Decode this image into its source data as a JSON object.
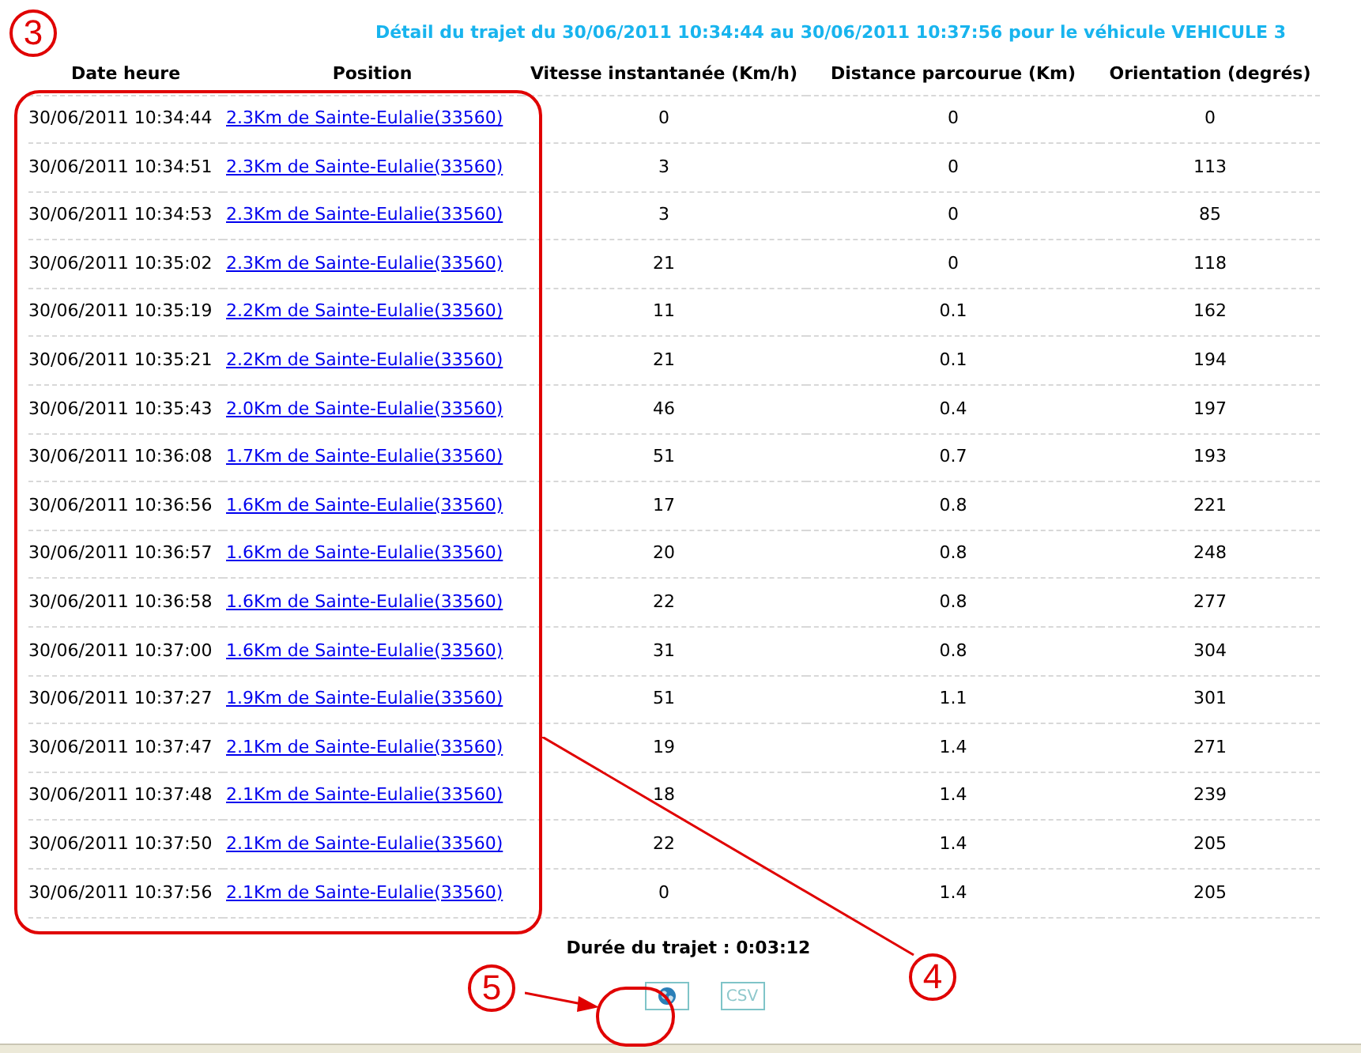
{
  "title": "Détail du trajet du 30/06/2011 10:34:44 au 30/06/2011 10:37:56 pour le véhicule VEHICULE 3",
  "columns": [
    "Date heure",
    "Position",
    "Vitesse instantanée (Km/h)",
    "Distance parcourue (Km)",
    "Orientation (degrés)"
  ],
  "rows": [
    {
      "date": "30/06/2011 10:34:44",
      "position": "2.3Km de Sainte-Eulalie(33560)",
      "speed": "0",
      "distance": "0",
      "orientation": "0"
    },
    {
      "date": "30/06/2011 10:34:51",
      "position": "2.3Km de Sainte-Eulalie(33560)",
      "speed": "3",
      "distance": "0",
      "orientation": "113"
    },
    {
      "date": "30/06/2011 10:34:53",
      "position": "2.3Km de Sainte-Eulalie(33560)",
      "speed": "3",
      "distance": "0",
      "orientation": "85"
    },
    {
      "date": "30/06/2011 10:35:02",
      "position": "2.3Km de Sainte-Eulalie(33560)",
      "speed": "21",
      "distance": "0",
      "orientation": "118"
    },
    {
      "date": "30/06/2011 10:35:19",
      "position": "2.2Km de Sainte-Eulalie(33560)",
      "speed": "11",
      "distance": "0.1",
      "orientation": "162"
    },
    {
      "date": "30/06/2011 10:35:21",
      "position": "2.2Km de Sainte-Eulalie(33560)",
      "speed": "21",
      "distance": "0.1",
      "orientation": "194"
    },
    {
      "date": "30/06/2011 10:35:43",
      "position": "2.0Km de Sainte-Eulalie(33560)",
      "speed": "46",
      "distance": "0.4",
      "orientation": "197"
    },
    {
      "date": "30/06/2011 10:36:08",
      "position": "1.7Km de Sainte-Eulalie(33560)",
      "speed": "51",
      "distance": "0.7",
      "orientation": "193"
    },
    {
      "date": "30/06/2011 10:36:56",
      "position": "1.6Km de Sainte-Eulalie(33560)",
      "speed": "17",
      "distance": "0.8",
      "orientation": "221"
    },
    {
      "date": "30/06/2011 10:36:57",
      "position": "1.6Km de Sainte-Eulalie(33560)",
      "speed": "20",
      "distance": "0.8",
      "orientation": "248"
    },
    {
      "date": "30/06/2011 10:36:58",
      "position": "1.6Km de Sainte-Eulalie(33560)",
      "speed": "22",
      "distance": "0.8",
      "orientation": "277"
    },
    {
      "date": "30/06/2011 10:37:00",
      "position": "1.6Km de Sainte-Eulalie(33560)",
      "speed": "31",
      "distance": "0.8",
      "orientation": "304"
    },
    {
      "date": "30/06/2011 10:37:27",
      "position": "1.9Km de Sainte-Eulalie(33560)",
      "speed": "51",
      "distance": "1.1",
      "orientation": "301"
    },
    {
      "date": "30/06/2011 10:37:47",
      "position": "2.1Km de Sainte-Eulalie(33560)",
      "speed": "19",
      "distance": "1.4",
      "orientation": "271"
    },
    {
      "date": "30/06/2011 10:37:48",
      "position": "2.1Km de Sainte-Eulalie(33560)",
      "speed": "18",
      "distance": "1.4",
      "orientation": "239"
    },
    {
      "date": "30/06/2011 10:37:50",
      "position": "2.1Km de Sainte-Eulalie(33560)",
      "speed": "22",
      "distance": "1.4",
      "orientation": "205"
    },
    {
      "date": "30/06/2011 10:37:56",
      "position": "2.1Km de Sainte-Eulalie(33560)",
      "speed": "0",
      "distance": "1.4",
      "orientation": "205"
    }
  ],
  "duration": "Durée du trajet : 0:03:12",
  "export_buttons": [
    {
      "kind": "map"
    },
    {
      "kind": "text",
      "label": "CSV"
    }
  ],
  "annotations": [
    "3",
    "4",
    "5"
  ]
}
